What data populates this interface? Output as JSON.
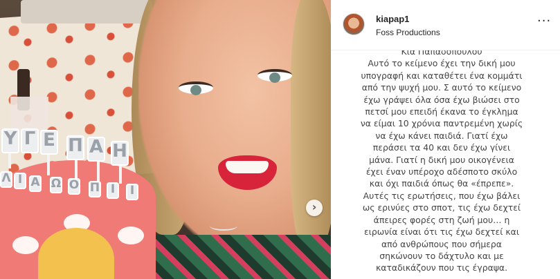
{
  "post": {
    "author": {
      "username": "kiapap1",
      "subtitle": "Foss Productions",
      "avatar_icon": "profile-avatar"
    },
    "more_options_icon": "ellipsis-icon",
    "more_options_glyph": "···",
    "next_slide_icon": "chevron-right-icon",
    "next_slide_glyph": "›",
    "photo_cake_letters": [
      "Υ",
      "Γ",
      "Ε",
      "Ι",
      "Α",
      "Π",
      "Ο",
      "Λ",
      "Ω",
      "Η",
      "Α",
      "Π",
      "Ι",
      "Ι"
    ],
    "caption": {
      "cut_off_top_line": "Κια Παπαδοπούλου",
      "lines": [
        "Αυτό το κείμενο έχει την δική μου",
        "υπογραφή και καταθέτει ένα κομμάτι",
        "από την ψυχή μου. Σ αυτό το κείμενο",
        "έχω γράψει όλα όσα έχω βιώσει στο",
        "πετσί μου επειδή έκανα το έγκλημα",
        "να είμαι 10 χρόνια παντρεμένη χωρίς",
        "να έχω κάνει παιδιά. Γιατί έχω",
        "περάσει τα 40 και δεν έχω γίνει",
        "μάνα. Γιατί η δική μου οικογένεια",
        "έχει έναν υπέροχο αδέσποτο σκύλο",
        "και όχι παιδιά όπως θα «έπρεπε».",
        "Αυτές τις ερωτήσεις, που έχω βάλει",
        "ως ερινύες στο σποτ, τις έχω δεχτεί",
        "άπειρες φορές στη ζωή μου… η",
        "ειρωνία είναι ότι τις έχω δεχτεί και",
        "από ανθρώπους που σήμερα",
        "σηκώνουν το δάχτυλο και με",
        "καταδικάζουν που τις έγραψα."
      ]
    }
  }
}
